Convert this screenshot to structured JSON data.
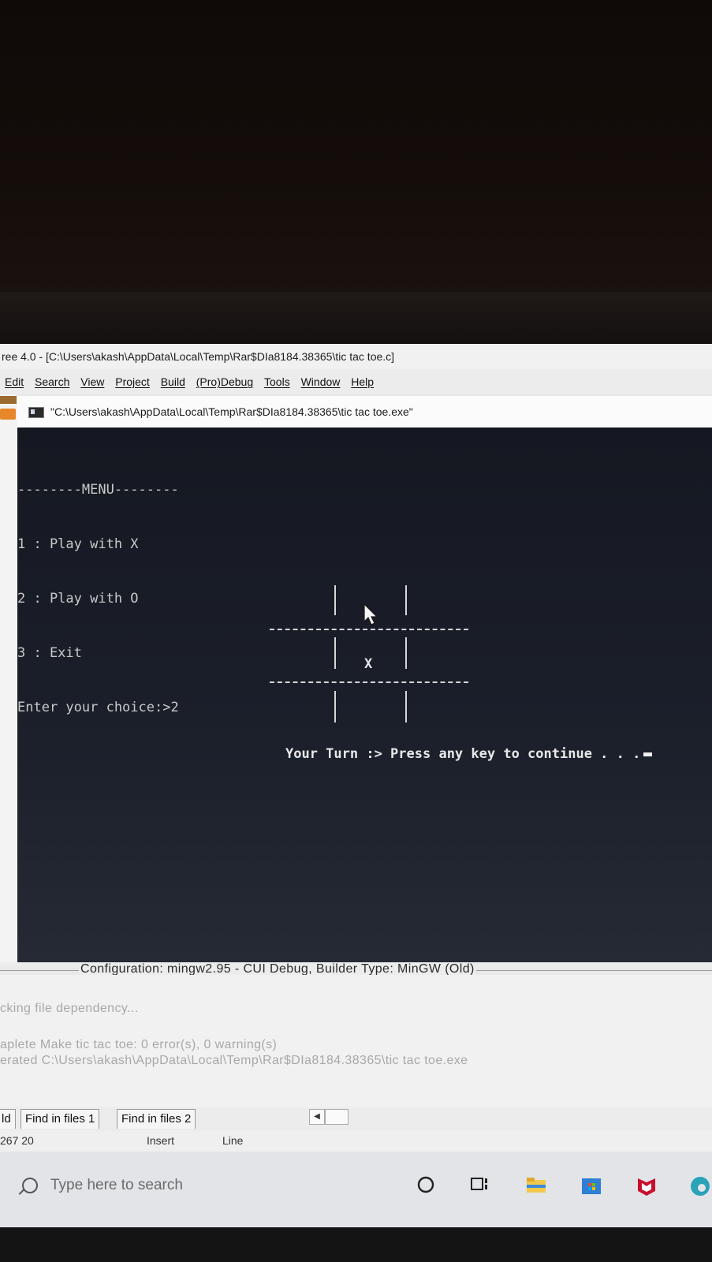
{
  "window": {
    "title": "ree 4.0 - [C:\\Users\\akash\\AppData\\Local\\Temp\\Rar$DIa8184.38365\\tic tac toe.c]"
  },
  "menubar": {
    "items": [
      "Edit",
      "Search",
      "View",
      "Project",
      "Build",
      "(Pro)Debug",
      "Tools",
      "Window",
      "Help"
    ]
  },
  "console": {
    "title": "\"C:\\Users\\akash\\AppData\\Local\\Temp\\Rar$DIa8184.38365\\tic tac toe.exe\"",
    "menu_lines": [
      "--------MENU--------",
      "1 : Play with X",
      "2 : Play with O",
      "3 : Exit",
      "Enter your choice:>2"
    ],
    "board_mark": "X",
    "turn_text": "Your Turn :> Press any key to continue . . ."
  },
  "build": {
    "configuration": "Configuration: mingw2.95 - CUI Debug, Builder Type: MinGW (Old)",
    "log_lines": [
      "cking file dependency...",
      "aplete Make tic tac toe: 0 error(s), 0 warning(s)",
      "erated C:\\Users\\akash\\AppData\\Local\\Temp\\Rar$DIa8184.38365\\tic tac toe.exe"
    ]
  },
  "tabs": [
    "ld",
    "Find in files 1",
    "Find in files 2"
  ],
  "status": {
    "position": "267  20",
    "mode": "Insert",
    "line_label": "Line"
  },
  "taskbar": {
    "search_placeholder": "Type here to search"
  },
  "colors": {
    "console_bg": "#1b1f2a",
    "console_text": "#c9c9c9",
    "taskbar_bg": "#e2e4e8"
  }
}
